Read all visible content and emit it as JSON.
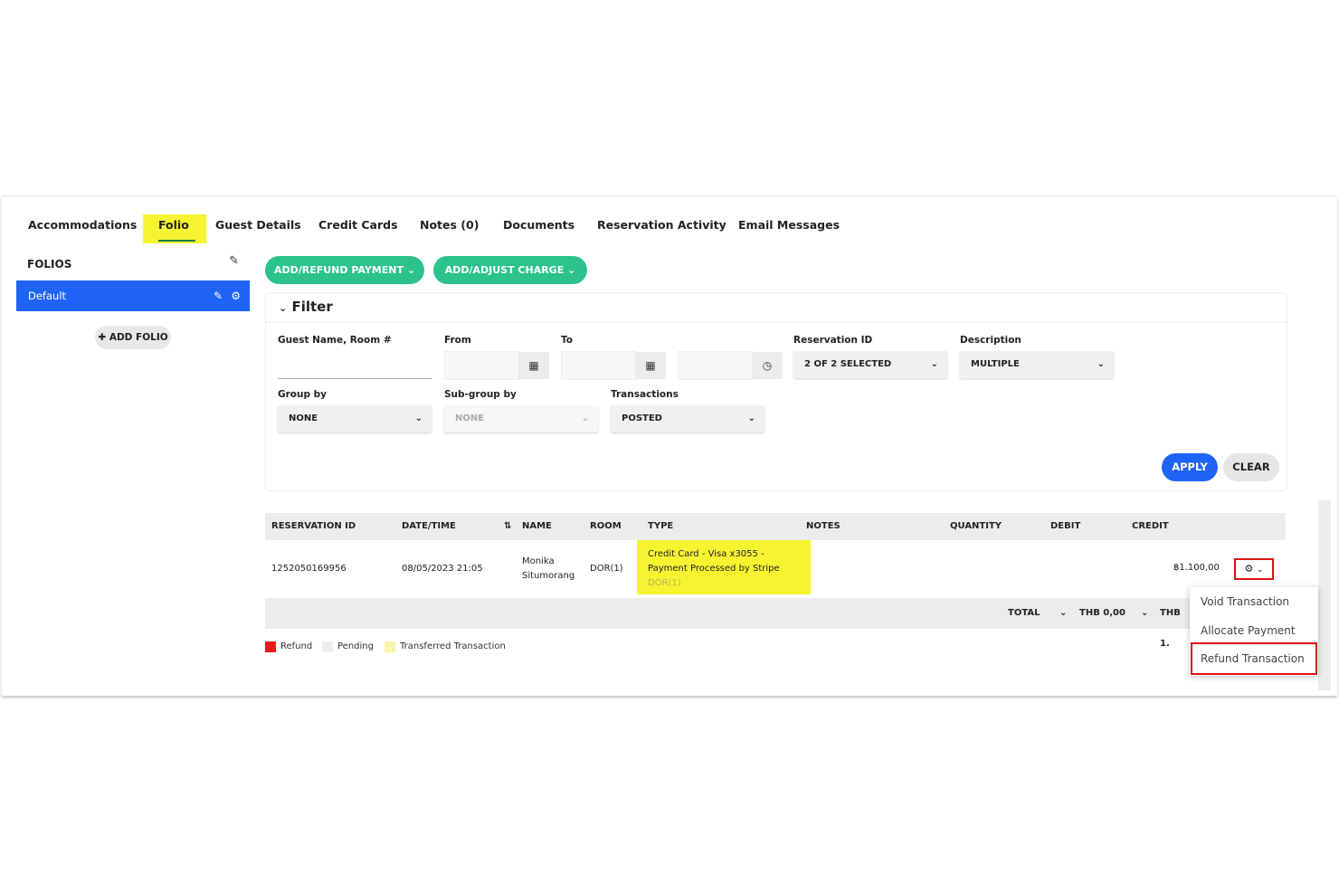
{
  "tabs": [
    "Accommodations",
    "Folio",
    "Guest Details",
    "Credit Cards",
    "Notes (0)",
    "Documents",
    "Reservation Activity",
    "Email Messages"
  ],
  "sidebar": {
    "title": "FOLIOS",
    "folio": "Default",
    "add_folio": "ADD FOLIO"
  },
  "actions": {
    "add_refund_payment": "ADD/REFUND PAYMENT",
    "add_adjust_charge": "ADD/ADJUST CHARGE"
  },
  "filter": {
    "title": "Filter",
    "guest_label": "Guest Name, Room #",
    "from_label": "From",
    "to_label": "To",
    "reservation_id_label": "Reservation ID",
    "reservation_id_value": "2 OF 2 SELECTED",
    "description_label": "Description",
    "description_value": "MULTIPLE",
    "group_by_label": "Group by",
    "group_by_value": "NONE",
    "subgroup_label": "Sub-group by",
    "subgroup_value": "NONE",
    "transactions_label": "Transactions",
    "transactions_value": "POSTED",
    "apply": "APPLY",
    "clear": "CLEAR"
  },
  "table": {
    "headers": [
      "RESERVATION ID",
      "DATE/TIME",
      "NAME",
      "ROOM",
      "TYPE",
      "NOTES",
      "QUANTITY",
      "DEBIT",
      "CREDIT"
    ],
    "row": {
      "reservation_id": "1252050169956",
      "datetime": "08/05/2023 21:05",
      "name_line1": "Monika",
      "name_line2": "Situmorang",
      "room": "DOR(1)",
      "type_line1": "Credit Card - Visa x3055 -",
      "type_line2": "Payment Processed by Stripe",
      "type_line3": "DOR(1)",
      "credit": "฿1.100,00"
    },
    "total_label": "TOTAL",
    "total_debit": "THB 0,00",
    "total_credit": "THB 1."
  },
  "row_menu": {
    "items": [
      "Void Transaction",
      "Allocate Payment",
      "Refund Transaction"
    ]
  },
  "legend": {
    "items": [
      {
        "label": "Refund",
        "color": "#e61b1b"
      },
      {
        "label": "Pending",
        "color": "#eeeeee"
      },
      {
        "label": "Transferred Transaction",
        "color": "#faf3a8"
      }
    ]
  },
  "colors": {
    "primary_blue": "#1f63f5",
    "green": "#2cc28c",
    "highlight_yellow": "#f6f431",
    "annotation_red": "#dd1111"
  }
}
